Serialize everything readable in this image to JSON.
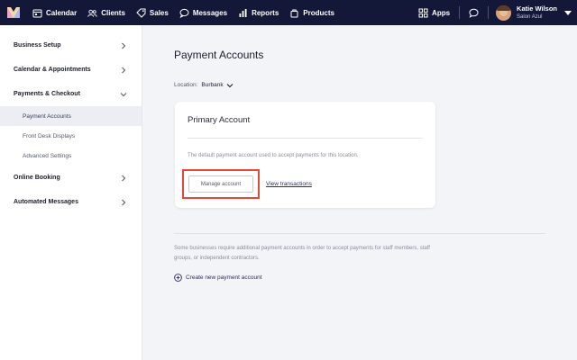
{
  "topnav": {
    "items": [
      {
        "label": "Calendar",
        "icon": "calendar-icon"
      },
      {
        "label": "Clients",
        "icon": "clients-icon"
      },
      {
        "label": "Sales",
        "icon": "sales-tag-icon"
      },
      {
        "label": "Messages",
        "icon": "messages-icon"
      },
      {
        "label": "Reports",
        "icon": "reports-chart-icon"
      },
      {
        "label": "Products",
        "icon": "products-bag-icon"
      }
    ],
    "apps_label": "Apps",
    "user": {
      "name": "Katie Wilson",
      "business": "Salon Azul"
    }
  },
  "sidebar": {
    "items": [
      {
        "label": "Business Setup"
      },
      {
        "label": "Calendar & Appointments"
      },
      {
        "label": "Payments & Checkout",
        "expanded": true,
        "children": [
          {
            "label": "Payment Accounts",
            "active": true
          },
          {
            "label": "Front Desk Displays"
          },
          {
            "label": "Advanced Settings"
          }
        ]
      },
      {
        "label": "Online Booking"
      },
      {
        "label": "Automated Messages"
      }
    ]
  },
  "main": {
    "title": "Payment Accounts",
    "location_label": "Location:",
    "location_value": "Burbank",
    "card": {
      "title": "Primary Account",
      "description": "The default payment account used to accept payments for this location.",
      "manage_label": "Manage account",
      "view_label": "View transactions"
    },
    "info_text": "Some businesses require additional payment accounts in order to accept payments for staff members, staff groups, or independent contractors.",
    "create_label": "Create new payment account"
  },
  "colors": {
    "topbar": "#141838",
    "highlight": "#e04a3b",
    "link": "#2b2d63",
    "active_bg": "#eceef4"
  }
}
